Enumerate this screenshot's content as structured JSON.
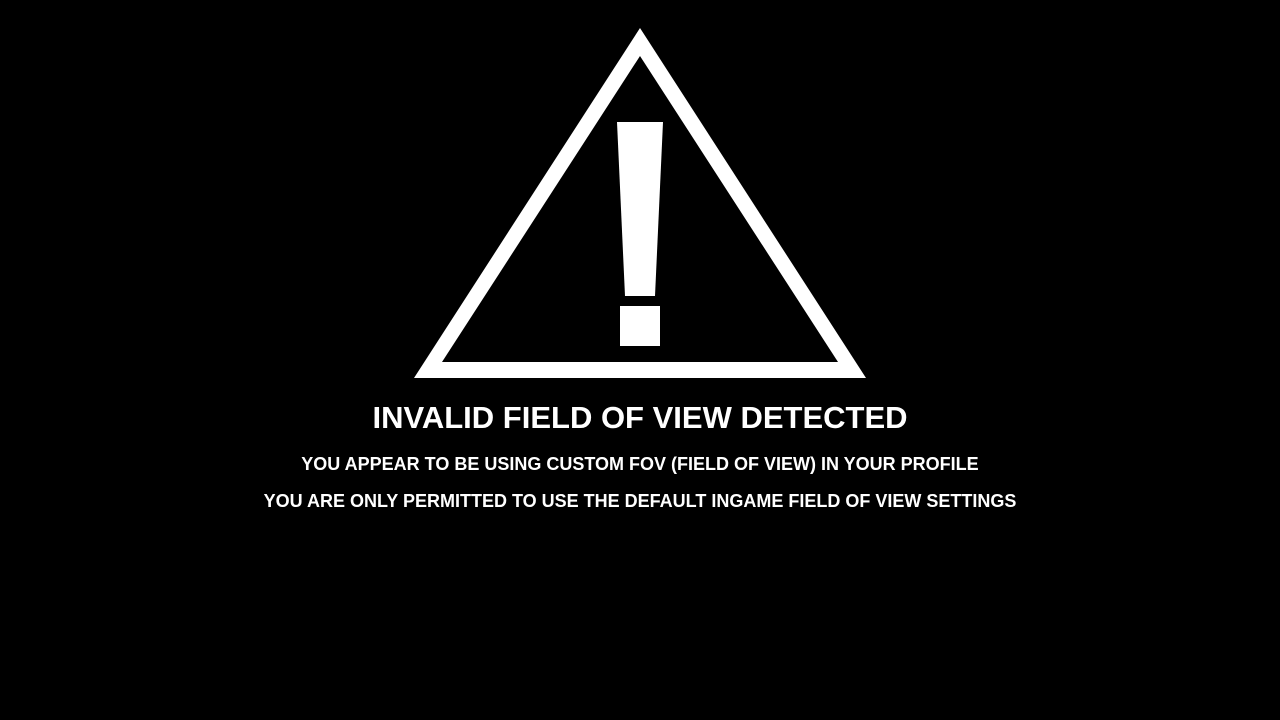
{
  "screen": {
    "background_color": "#000000",
    "text_color": "#ffffff",
    "icon": "warning-triangle-exclamation-icon",
    "title": "INVALID FIELD OF VIEW DETECTED",
    "message_lines": [
      "YOU APPEAR TO BE USING CUSTOM FOV (FIELD OF VIEW) IN YOUR PROFILE",
      "YOU ARE ONLY PERMITTED TO USE THE DEFAULT INGAME FIELD OF VIEW SETTINGS"
    ]
  }
}
